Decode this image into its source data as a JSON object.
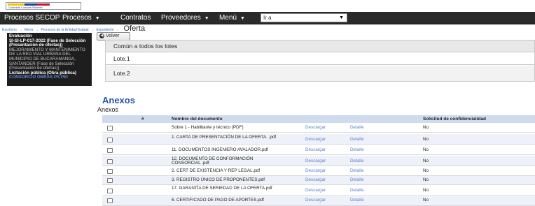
{
  "logo": {
    "text": "Colombia Compra Eficiente"
  },
  "topnav": {
    "items": [
      {
        "label": "Procesos SECOP",
        "caret": false
      },
      {
        "label": "Procesos",
        "caret": true
      },
      {
        "label": "Contratos",
        "caret": false
      },
      {
        "label": "Proveedores",
        "caret": true
      },
      {
        "label": "Menú",
        "caret": true
      }
    ],
    "ir_a": "Ir a"
  },
  "breadcrumb": {
    "items": [
      "Escritorio",
      "Menú",
      "Procesos de la Entidad Estatal",
      "Expediente"
    ],
    "current": "Oferta"
  },
  "left_panel": {
    "heading": "Evaluación",
    "process_id": "SI-SI-LP-017-2022 (Fase de Selección (Presentación de ofertas))",
    "description": "MEJORAMIENTO Y MANTENIMIENTO DE LA RED VIAL URBANA DEL MUNICIPIO DE BUCARAMANGA, SANTANDER (Fase de Selección (Presentación de ofertas))",
    "modality": "Licitación pública (Obra pública)",
    "bidder": "CONSORCIO OBRAS PS PEI"
  },
  "volver_label": "Volver",
  "lotes": {
    "rows": [
      "Común a todos los lotes",
      "Lote.1",
      "Lote.2"
    ]
  },
  "anexos": {
    "title": "Anexos",
    "subtitle": "Anexos",
    "columns": [
      "#",
      "Nombre del documento",
      "Solicitud de confidencialidad"
    ],
    "rows": [
      {
        "nombre": "Sobre 1 - Habilitante y técnico (PDF)",
        "descargar": "Descargar",
        "detalle": "Detalle",
        "solicitud": "No"
      },
      {
        "nombre": "1. CARTA DE PRESENTACIÓN DE LA OFERTA. .pdf",
        "descargar": "Descargar",
        "detalle": "Detalle",
        "solicitud": "No"
      },
      {
        "nombre": "11. DOCUMENTOS INGENIERO AVALADOR.pdf",
        "descargar": "Descargar",
        "detalle": "Detalle",
        "solicitud": "No"
      },
      {
        "nombre": "12. DOCUMENTO DE CONFORMACIÓN CONSORCIAL .pdf",
        "descargar": "Descargar",
        "detalle": "Detalle",
        "solicitud": "No"
      },
      {
        "nombre": "2. CERT DE EXISTENCIA Y REP LEGAL.pdf",
        "descargar": "Descargar",
        "detalle": "Detalle",
        "solicitud": "No"
      },
      {
        "nombre": "3. REGISTRO ÚNICO DE PROPONENTES.pdf",
        "descargar": "Descargar",
        "detalle": "Detalle",
        "solicitud": "No"
      },
      {
        "nombre": "17. GARANTÍA DE SERIEDAD DE LA OFERTA.pdf",
        "descargar": "Descargar",
        "detalle": "Detalle",
        "solicitud": "No"
      },
      {
        "nombre": "6. CERTIFICADO DE PAGO DE APORTES.pdf",
        "descargar": "Descargar",
        "detalle": "Detalle",
        "solicitud": "No"
      }
    ]
  },
  "colors": {
    "nav_bg": "#2a2a2a",
    "link": "#5b7fd3",
    "title": "#2656a8",
    "header_bg": "#cfdcef"
  }
}
